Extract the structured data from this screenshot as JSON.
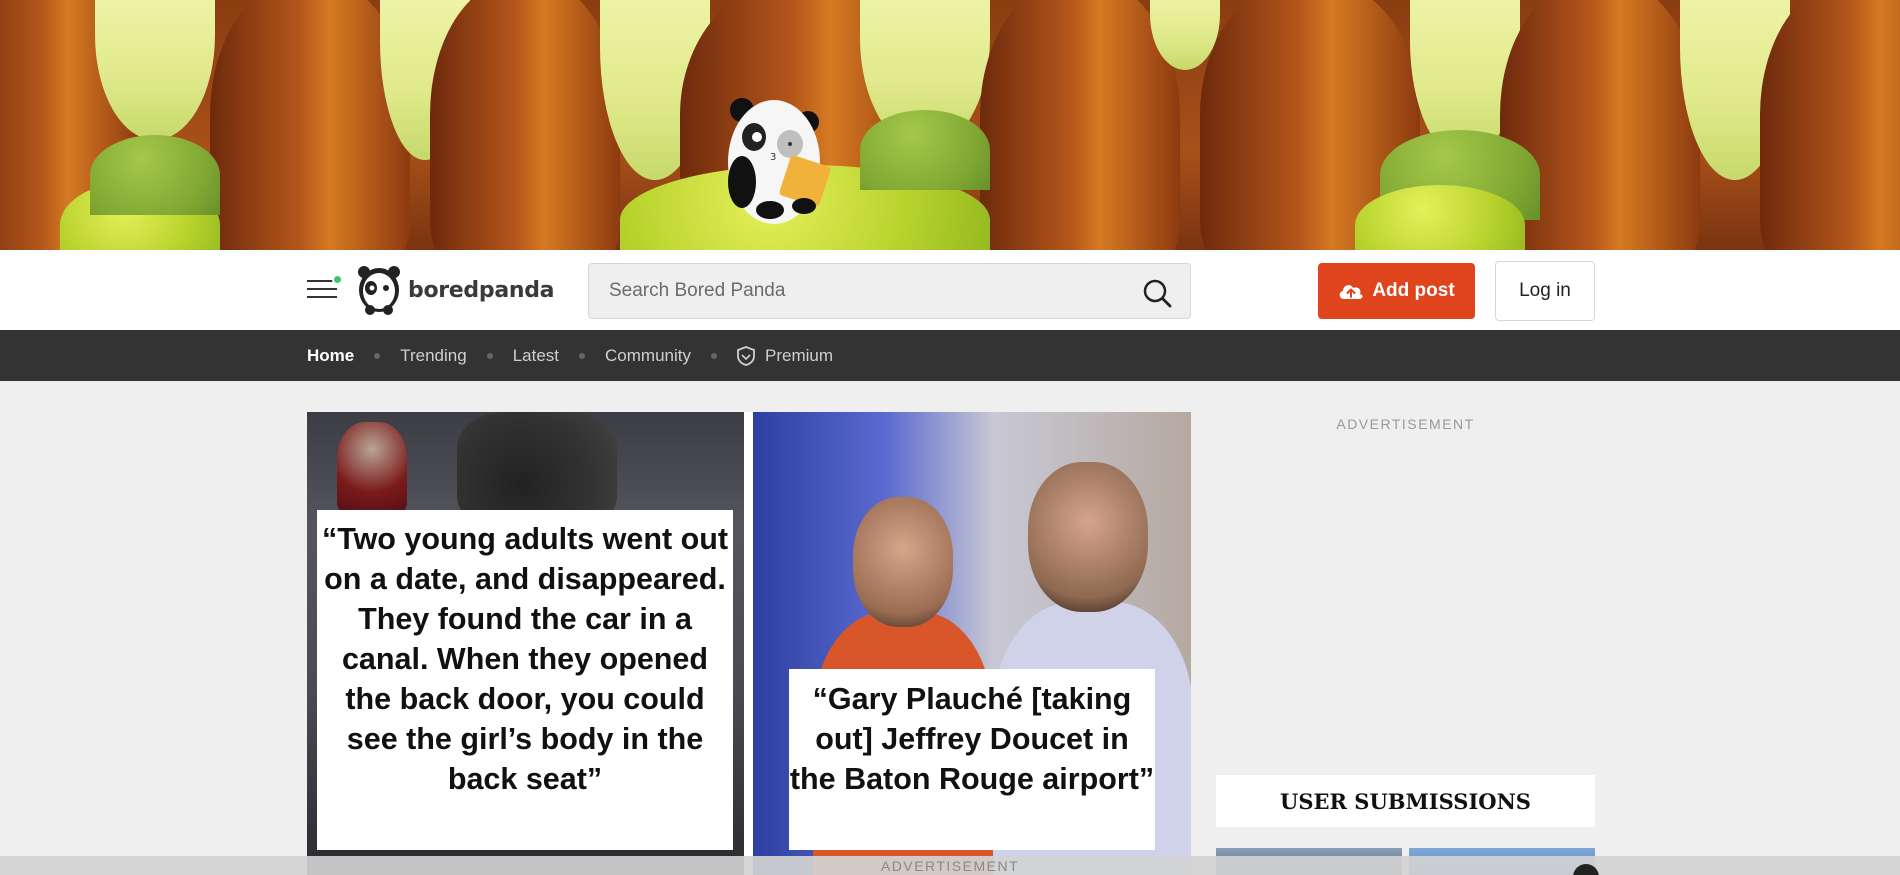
{
  "header": {
    "logo_text": "boredpanda",
    "search_placeholder": "Search Bored Panda",
    "add_post_label": "Add post",
    "login_label": "Log in"
  },
  "nav": {
    "items": [
      {
        "label": "Home",
        "active": true
      },
      {
        "label": "Trending"
      },
      {
        "label": "Latest"
      },
      {
        "label": "Community"
      },
      {
        "label": "Premium"
      }
    ]
  },
  "featured": {
    "caption_left": "“Two young adults went out on a date, and disappeared. They found the car in a canal. When they opened the back door, you could see the girl’s body in the back seat”",
    "caption_right": "“Gary Plauché [taking out] Jeffrey Doucet in the Baton Rouge airport”"
  },
  "sidebar": {
    "ad_label": "ADVERTISEMENT",
    "user_submissions_title": "USER SUBMISSIONS"
  },
  "bottom_ad": {
    "label": "ADVERTISEMENT"
  },
  "colors": {
    "accent": "#e0441d",
    "nav_bg": "#333333",
    "notification_dot": "#3ec46d"
  },
  "icons": [
    "hamburger-menu-icon",
    "panda-logo-icon",
    "search-icon",
    "upload-cloud-icon",
    "shield-premium-icon"
  ]
}
